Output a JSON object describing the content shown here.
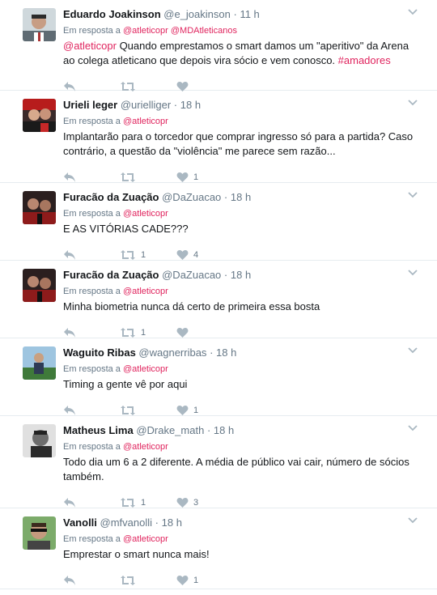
{
  "tweets": [
    {
      "name": "Eduardo Joakinson",
      "handle": "@e_joakinson",
      "time": "11 h",
      "reply_prefix": "Em resposta a",
      "reply_to": [
        "@atleticopr",
        "@MDAtleticanos"
      ],
      "text_parts": [
        "@atleticopr",
        " Quando emprestamos o smart damos um \"aperitivo\" da Arena ao colega atleticano que depois vira sócio e vem conosco. ",
        "#amadores"
      ],
      "retweets": "",
      "likes": ""
    },
    {
      "name": "Urieli leger",
      "handle": "@urielliger",
      "time": "18 h",
      "reply_prefix": "Em resposta a",
      "reply_to": [
        "@atleticopr"
      ],
      "text": "Implantarão para o torcedor que comprar ingresso só para a partida? Caso contrário, a questão da \"violência\" me parece sem razão...",
      "retweets": "",
      "likes": "1"
    },
    {
      "name": "Furacão da Zuação",
      "handle": "@DaZuacao",
      "time": "18 h",
      "reply_prefix": "Em resposta a",
      "reply_to": [
        "@atleticopr"
      ],
      "text": "E AS VITÓRIAS CADE???",
      "retweets": "1",
      "likes": "4"
    },
    {
      "name": "Furacão da Zuação",
      "handle": "@DaZuacao",
      "time": "18 h",
      "reply_prefix": "Em resposta a",
      "reply_to": [
        "@atleticopr"
      ],
      "text": "Minha biometria nunca dá certo de primeira essa bosta",
      "retweets": "1",
      "likes": ""
    },
    {
      "name": "Waguito Ribas",
      "handle": "@wagnerribas",
      "time": "18 h",
      "reply_prefix": "Em resposta a",
      "reply_to": [
        "@atleticopr"
      ],
      "text": "Timing a gente vê por aqui",
      "retweets": "",
      "likes": "1"
    },
    {
      "name": "Matheus Lima",
      "handle": "@Drake_math",
      "time": "18 h",
      "reply_prefix": "Em resposta a",
      "reply_to": [
        "@atleticopr"
      ],
      "text": "Todo dia um 6 a 2 diferente. A média de público vai cair, número de sócios também.",
      "retweets": "1",
      "likes": "3"
    },
    {
      "name": "Vanolli",
      "handle": "@mfvanolli",
      "time": "18 h",
      "reply_prefix": "Em resposta a",
      "reply_to": [
        "@atleticopr"
      ],
      "text": "Emprestar o smart nunca mais!",
      "retweets": "",
      "likes": "1"
    }
  ],
  "icons": {
    "reply": "reply-icon",
    "retweet": "retweet-icon",
    "like": "heart-icon",
    "caret": "chevron-down-icon"
  },
  "colors": {
    "link": "#e0245e",
    "muted": "#657786",
    "icon": "#aab8c2",
    "border": "#e6ecf0"
  }
}
